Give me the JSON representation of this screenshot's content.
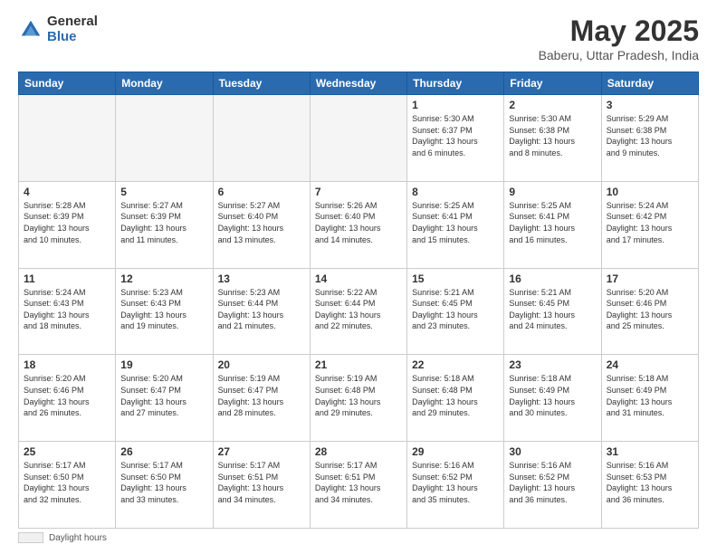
{
  "header": {
    "logo_general": "General",
    "logo_blue": "Blue",
    "title": "May 2025",
    "subtitle": "Baberu, Uttar Pradesh, India"
  },
  "days_of_week": [
    "Sunday",
    "Monday",
    "Tuesday",
    "Wednesday",
    "Thursday",
    "Friday",
    "Saturday"
  ],
  "weeks": [
    [
      {
        "day": "",
        "info": ""
      },
      {
        "day": "",
        "info": ""
      },
      {
        "day": "",
        "info": ""
      },
      {
        "day": "",
        "info": ""
      },
      {
        "day": "1",
        "info": "Sunrise: 5:30 AM\nSunset: 6:37 PM\nDaylight: 13 hours\nand 6 minutes."
      },
      {
        "day": "2",
        "info": "Sunrise: 5:30 AM\nSunset: 6:38 PM\nDaylight: 13 hours\nand 8 minutes."
      },
      {
        "day": "3",
        "info": "Sunrise: 5:29 AM\nSunset: 6:38 PM\nDaylight: 13 hours\nand 9 minutes."
      }
    ],
    [
      {
        "day": "4",
        "info": "Sunrise: 5:28 AM\nSunset: 6:39 PM\nDaylight: 13 hours\nand 10 minutes."
      },
      {
        "day": "5",
        "info": "Sunrise: 5:27 AM\nSunset: 6:39 PM\nDaylight: 13 hours\nand 11 minutes."
      },
      {
        "day": "6",
        "info": "Sunrise: 5:27 AM\nSunset: 6:40 PM\nDaylight: 13 hours\nand 13 minutes."
      },
      {
        "day": "7",
        "info": "Sunrise: 5:26 AM\nSunset: 6:40 PM\nDaylight: 13 hours\nand 14 minutes."
      },
      {
        "day": "8",
        "info": "Sunrise: 5:25 AM\nSunset: 6:41 PM\nDaylight: 13 hours\nand 15 minutes."
      },
      {
        "day": "9",
        "info": "Sunrise: 5:25 AM\nSunset: 6:41 PM\nDaylight: 13 hours\nand 16 minutes."
      },
      {
        "day": "10",
        "info": "Sunrise: 5:24 AM\nSunset: 6:42 PM\nDaylight: 13 hours\nand 17 minutes."
      }
    ],
    [
      {
        "day": "11",
        "info": "Sunrise: 5:24 AM\nSunset: 6:43 PM\nDaylight: 13 hours\nand 18 minutes."
      },
      {
        "day": "12",
        "info": "Sunrise: 5:23 AM\nSunset: 6:43 PM\nDaylight: 13 hours\nand 19 minutes."
      },
      {
        "day": "13",
        "info": "Sunrise: 5:23 AM\nSunset: 6:44 PM\nDaylight: 13 hours\nand 21 minutes."
      },
      {
        "day": "14",
        "info": "Sunrise: 5:22 AM\nSunset: 6:44 PM\nDaylight: 13 hours\nand 22 minutes."
      },
      {
        "day": "15",
        "info": "Sunrise: 5:21 AM\nSunset: 6:45 PM\nDaylight: 13 hours\nand 23 minutes."
      },
      {
        "day": "16",
        "info": "Sunrise: 5:21 AM\nSunset: 6:45 PM\nDaylight: 13 hours\nand 24 minutes."
      },
      {
        "day": "17",
        "info": "Sunrise: 5:20 AM\nSunset: 6:46 PM\nDaylight: 13 hours\nand 25 minutes."
      }
    ],
    [
      {
        "day": "18",
        "info": "Sunrise: 5:20 AM\nSunset: 6:46 PM\nDaylight: 13 hours\nand 26 minutes."
      },
      {
        "day": "19",
        "info": "Sunrise: 5:20 AM\nSunset: 6:47 PM\nDaylight: 13 hours\nand 27 minutes."
      },
      {
        "day": "20",
        "info": "Sunrise: 5:19 AM\nSunset: 6:47 PM\nDaylight: 13 hours\nand 28 minutes."
      },
      {
        "day": "21",
        "info": "Sunrise: 5:19 AM\nSunset: 6:48 PM\nDaylight: 13 hours\nand 29 minutes."
      },
      {
        "day": "22",
        "info": "Sunrise: 5:18 AM\nSunset: 6:48 PM\nDaylight: 13 hours\nand 29 minutes."
      },
      {
        "day": "23",
        "info": "Sunrise: 5:18 AM\nSunset: 6:49 PM\nDaylight: 13 hours\nand 30 minutes."
      },
      {
        "day": "24",
        "info": "Sunrise: 5:18 AM\nSunset: 6:49 PM\nDaylight: 13 hours\nand 31 minutes."
      }
    ],
    [
      {
        "day": "25",
        "info": "Sunrise: 5:17 AM\nSunset: 6:50 PM\nDaylight: 13 hours\nand 32 minutes."
      },
      {
        "day": "26",
        "info": "Sunrise: 5:17 AM\nSunset: 6:50 PM\nDaylight: 13 hours\nand 33 minutes."
      },
      {
        "day": "27",
        "info": "Sunrise: 5:17 AM\nSunset: 6:51 PM\nDaylight: 13 hours\nand 34 minutes."
      },
      {
        "day": "28",
        "info": "Sunrise: 5:17 AM\nSunset: 6:51 PM\nDaylight: 13 hours\nand 34 minutes."
      },
      {
        "day": "29",
        "info": "Sunrise: 5:16 AM\nSunset: 6:52 PM\nDaylight: 13 hours\nand 35 minutes."
      },
      {
        "day": "30",
        "info": "Sunrise: 5:16 AM\nSunset: 6:52 PM\nDaylight: 13 hours\nand 36 minutes."
      },
      {
        "day": "31",
        "info": "Sunrise: 5:16 AM\nSunset: 6:53 PM\nDaylight: 13 hours\nand 36 minutes."
      }
    ]
  ],
  "footer": {
    "label": "Daylight hours"
  }
}
